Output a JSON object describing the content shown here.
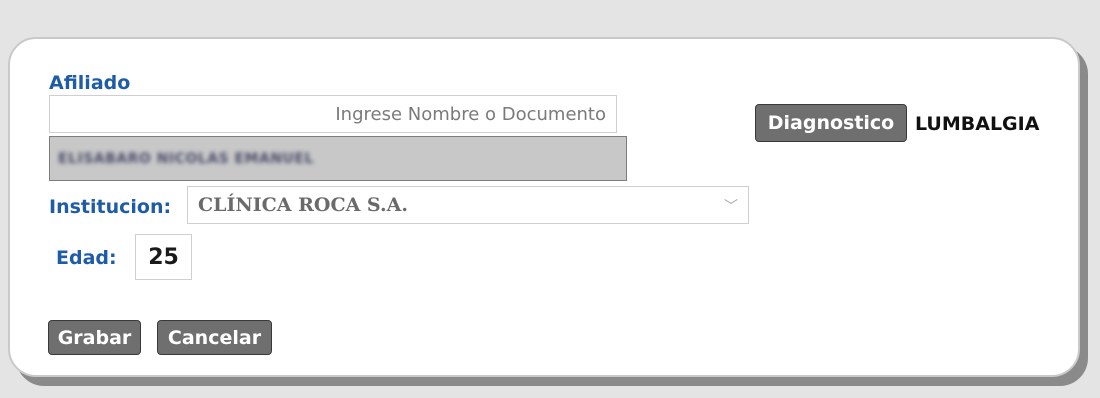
{
  "form": {
    "afiliado_label": "Afiliado",
    "search_placeholder": "Ingrese Nombre o Documento",
    "selected_name": "ELISABARO NICOLAS EMANUEL",
    "institucion_label": "Institucion:",
    "institucion_value": "CLÍNICA ROCA S.A.",
    "edad_label": "Edad:",
    "edad_value": "25"
  },
  "diagnostico": {
    "button_label": "Diagnostico",
    "value": "LUMBALGIA"
  },
  "actions": {
    "save_label": "Grabar",
    "cancel_label": "Cancelar"
  },
  "colors": {
    "label_blue": "#1e5ca8",
    "button_gray": "#6f6f6f",
    "background": "#e4e4e4"
  }
}
